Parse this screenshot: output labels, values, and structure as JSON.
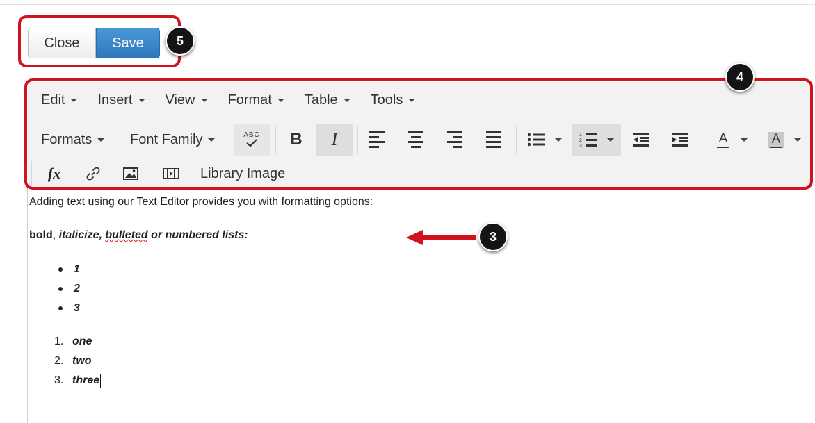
{
  "actions": {
    "close_label": "Close",
    "save_label": "Save"
  },
  "callouts": {
    "save_group": "5",
    "toolbar": "4",
    "content": "3"
  },
  "menubar": [
    {
      "label": "Edit"
    },
    {
      "label": "Insert"
    },
    {
      "label": "View"
    },
    {
      "label": "Format"
    },
    {
      "label": "Table"
    },
    {
      "label": "Tools"
    }
  ],
  "toolbar": {
    "formats_label": "Formats",
    "font_family_label": "Font Family",
    "spellcheck_text": "ABC",
    "bold_glyph": "B",
    "italic_glyph": "I",
    "text_color_glyph": "A",
    "bg_color_glyph": "A",
    "equation_glyph": "fx",
    "library_image_label": "Library Image",
    "active_buttons": [
      "italic",
      "numbered-list"
    ]
  },
  "content": {
    "intro": "Adding text using our Text Editor provides you with formatting options:",
    "subtitle": {
      "bold": "bold",
      "comma": ", ",
      "italic_pre": "italicize, ",
      "underlined": "bulleted",
      "italic_post": " or numbered lists:"
    },
    "bullets": [
      "1",
      "2",
      "3"
    ],
    "numbered": [
      {
        "num": "1.",
        "text": "one"
      },
      {
        "num": "2.",
        "text": "two"
      },
      {
        "num": "3.",
        "text": "three"
      }
    ]
  },
  "colors": {
    "callout_red": "#d0131f",
    "save_blue": "#3a86c8",
    "badge_black": "#141414"
  }
}
